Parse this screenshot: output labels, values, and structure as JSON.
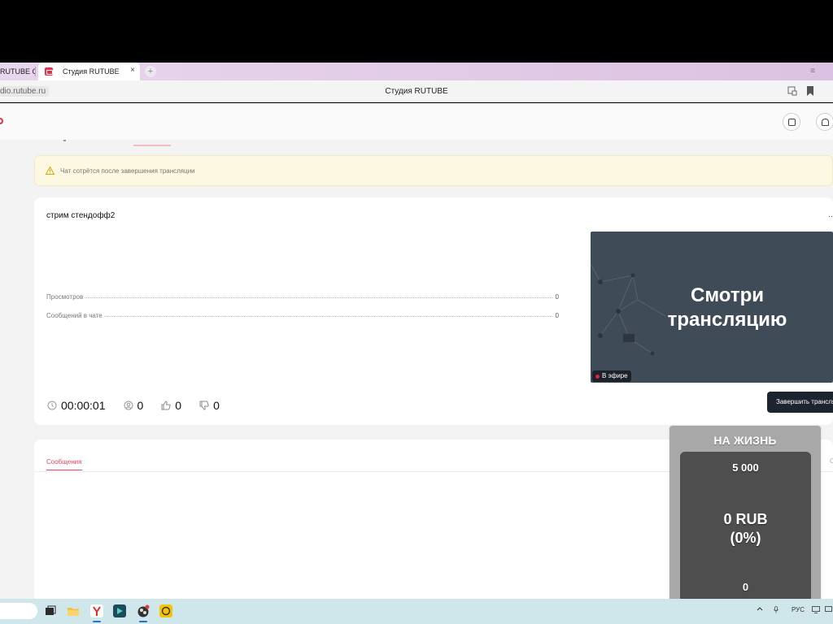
{
  "browser": {
    "tabs": [
      {
        "label": "RUTUBE С",
        "active": false
      },
      {
        "label": "Студия RUTUBE",
        "active": true
      }
    ],
    "close_glyph": "×",
    "newtab_glyph": "+",
    "menu_glyph": "≡",
    "url": "dio.rutube.ru",
    "page_title": "Студия RUTUBE"
  },
  "notice": {
    "icon": "warning-triangle-icon",
    "text": "Чат сотрётся после завершения трансляции"
  },
  "stream": {
    "title": "стрим стендофф2",
    "menu_glyph": "⋯",
    "stats": [
      {
        "label": "Просмотров",
        "value": "0"
      },
      {
        "label": "Сообщений в чате",
        "value": "0"
      }
    ],
    "timer": "00:00:01",
    "viewers": "0",
    "likes": "0",
    "dislikes": "0",
    "preview_text": "Смотри трансляцию",
    "live_label": "В эфире",
    "end_button": "Завершить трансляцию"
  },
  "chat": {
    "tab_label": "Сообщения",
    "right_fragment": "С"
  },
  "donation_widget": {
    "title": "НА ЖИЗНЬ",
    "goal": "5 000",
    "amount": "0 RUB",
    "percent": "(0%)",
    "min": "0",
    "progress_fraction": 0
  },
  "taskbar": {
    "tray_lang": "РУС"
  },
  "colors": {
    "accent": "#ea2f4c",
    "dark_button": "#1c2430",
    "warning_bg": "#fdf8e1",
    "preview_bg": "#3f4b57",
    "widget_box": "#4e4e4e",
    "widget_frame": "#a8a8a8",
    "taskbar": "#cfe6ea"
  }
}
